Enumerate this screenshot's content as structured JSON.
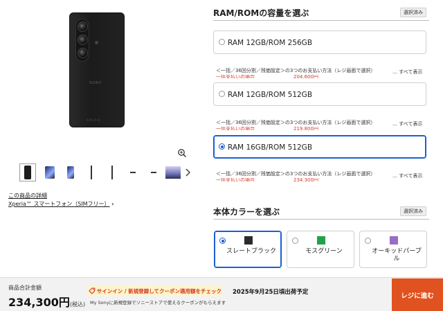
{
  "gallery": {
    "phone_brand": "SONY",
    "phone_model_text": "XPERIA",
    "thumbnails_count": 8,
    "detail_link": "この商品の詳細",
    "breadcrumb": "Xperia™ スマートフォン（SIMフリー）",
    "breadcrumb_arrow": "›"
  },
  "storage_section": {
    "title": "RAM/ROMの容量を選ぶ",
    "badge": "選択済み",
    "options": [
      {
        "label": "RAM 12GB/ROM 256GB",
        "selected": false,
        "payment_note": "＜一括／36回分割／残価設定＞の3つのお支払い方法（レジ画面で選択）",
        "price_line": "一括支払いの場合　　　　　　　　204,600円",
        "show_all": "… すべて表示"
      },
      {
        "label": "RAM 12GB/ROM 512GB",
        "selected": false,
        "payment_note": "＜一括／36回分割／残価設定＞の3つのお支払い方法（レジ画面で選択）",
        "price_line": "一括支払いの場合　　　　　　　　219,800円",
        "show_all": "… すべて表示"
      },
      {
        "label": "RAM 16GB/ROM 512GB",
        "selected": true,
        "payment_note": "＜一括／36回分割／残価設定＞の3つのお支払い方法（レジ画面で選択）",
        "price_line": "一括支払いの場合　　　　　　　　234,300円",
        "show_all": "… すべて表示"
      }
    ]
  },
  "color_section": {
    "title": "本体カラーを選ぶ",
    "badge": "選択済み",
    "options": [
      {
        "label": "スレートブラック",
        "swatch": "#2b2b2b",
        "selected": true
      },
      {
        "label": "モスグリーン",
        "swatch": "#22a34a",
        "selected": false
      },
      {
        "label": "オーキッドパープル",
        "swatch": "#9b6cc4",
        "selected": false
      }
    ]
  },
  "bottom_bar": {
    "total_label": "商品合計金額",
    "total_price": "234,300円",
    "total_tax": "(税込)",
    "coupon_text": "サインイン / 新規登録してクーポン適用額をチェック",
    "coupon_sub": "My Sonyに新規登録でソニーストアで使えるクーポンがもらえます",
    "ship_date": "2025年9月25日頃出荷予定",
    "checkout_label": "レジに進む"
  },
  "colors": {
    "accent_blue": "#1a5fd0",
    "checkout_orange": "#e0521f",
    "price_red": "#d23a2a"
  }
}
